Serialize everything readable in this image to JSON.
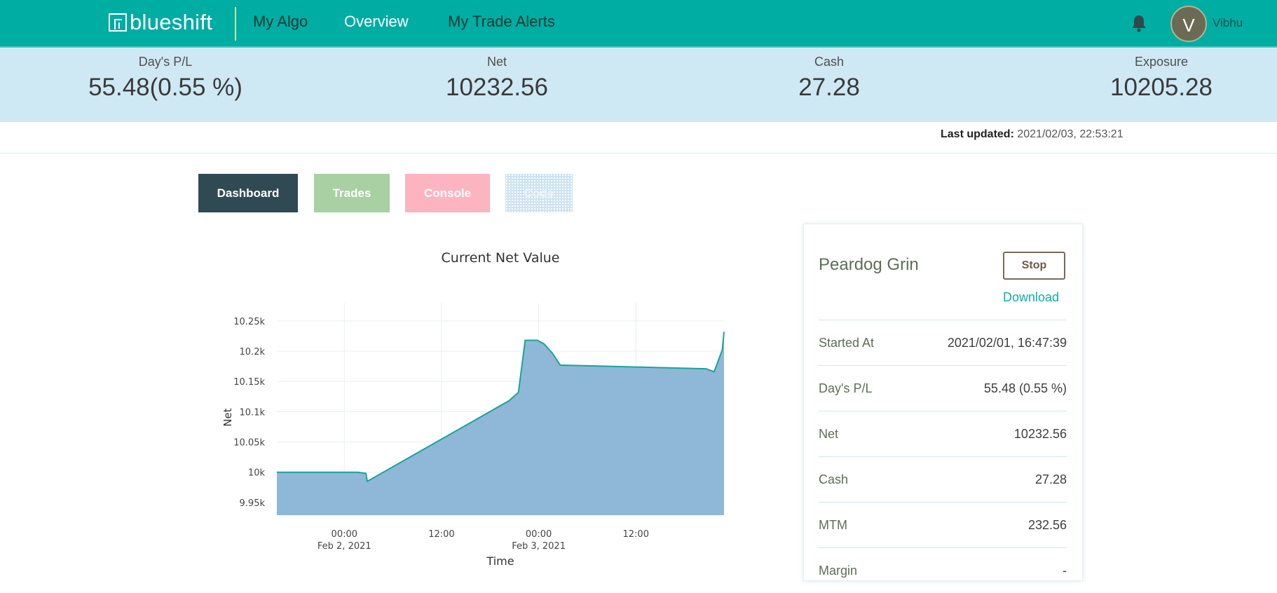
{
  "app": {
    "logo_text": "blueshift",
    "logo_icon": "blueshift-logo-icon"
  },
  "nav": {
    "items": [
      {
        "label": "My Algo",
        "active": false
      },
      {
        "label": "Overview",
        "active": true
      },
      {
        "label": "My Trade Alerts",
        "active": false
      }
    ],
    "bell_icon": "bell-icon",
    "user": {
      "initial": "V",
      "name": "Vibhu"
    }
  },
  "stats": [
    {
      "label": "Day's P/L",
      "value": "55.48(0.55 %)"
    },
    {
      "label": "Net",
      "value": "10232.56"
    },
    {
      "label": "Cash",
      "value": "27.28"
    },
    {
      "label": "Exposure",
      "value": "10205.28"
    }
  ],
  "last_updated": {
    "label": "Last updated:",
    "value": "2021/02/03, 22:53:21"
  },
  "tabs": [
    {
      "label": "Dashboard",
      "active": true
    },
    {
      "label": "Trades",
      "active": false
    },
    {
      "label": "Console",
      "active": false
    },
    {
      "label": "Code",
      "active": false
    }
  ],
  "colors": {
    "brand": "#00ada3",
    "area_fill": "#8fb8d8",
    "area_line": "#1aa39a"
  },
  "chart_data": {
    "type": "area",
    "title": "Current Net Value",
    "xlabel": "Time",
    "ylabel": "Net",
    "x_ticks": [
      {
        "t": "2021-02-02 00:00",
        "line1": "00:00",
        "line2": "Feb 2, 2021"
      },
      {
        "t": "2021-02-02 12:00",
        "line1": "12:00",
        "line2": ""
      },
      {
        "t": "2021-02-03 00:00",
        "line1": "00:00",
        "line2": "Feb 3, 2021"
      },
      {
        "t": "2021-02-03 12:00",
        "line1": "12:00",
        "line2": ""
      }
    ],
    "y_ticks": [
      {
        "v": 9950,
        "label": "9.95k"
      },
      {
        "v": 10000,
        "label": "10k"
      },
      {
        "v": 10050,
        "label": "10.05k"
      },
      {
        "v": 10100,
        "label": "10.1k"
      },
      {
        "v": 10150,
        "label": "10.15k"
      },
      {
        "v": 10200,
        "label": "10.2k"
      },
      {
        "v": 10250,
        "label": "10.25k"
      }
    ],
    "xlim": [
      "2021-02-01 15:40",
      "2021-02-03 22:53"
    ],
    "ylim": [
      9929,
      10280
    ],
    "grid": true,
    "points": [
      {
        "x": "2021-02-01 15:40",
        "y": 10000
      },
      {
        "x": "2021-02-02 01:40",
        "y": 10000
      },
      {
        "x": "2021-02-02 02:40",
        "y": 9998
      },
      {
        "x": "2021-02-02 02:50",
        "y": 9985
      },
      {
        "x": "2021-02-02 20:20",
        "y": 10118
      },
      {
        "x": "2021-02-02 21:30",
        "y": 10132
      },
      {
        "x": "2021-02-02 22:20",
        "y": 10218
      },
      {
        "x": "2021-02-02 23:50",
        "y": 10218
      },
      {
        "x": "2021-02-03 00:40",
        "y": 10212
      },
      {
        "x": "2021-02-03 01:40",
        "y": 10197
      },
      {
        "x": "2021-02-03 02:40",
        "y": 10177
      },
      {
        "x": "2021-02-03 20:40",
        "y": 10171
      },
      {
        "x": "2021-02-03 21:40",
        "y": 10166
      },
      {
        "x": "2021-02-03 22:40",
        "y": 10202
      },
      {
        "x": "2021-02-03 22:53",
        "y": 10232
      }
    ]
  },
  "panel": {
    "algo_name": "Peardog Grin",
    "stop_label": "Stop",
    "download_label": "Download",
    "rows": [
      {
        "label": "Started At",
        "value": "2021/02/01, 16:47:39"
      },
      {
        "label": "Day's P/L",
        "value": "55.48 (0.55 %)"
      },
      {
        "label": "Net",
        "value": "10232.56"
      },
      {
        "label": "Cash",
        "value": "27.28"
      },
      {
        "label": "MTM",
        "value": "232.56"
      },
      {
        "label": "Margin",
        "value": "-"
      }
    ]
  }
}
